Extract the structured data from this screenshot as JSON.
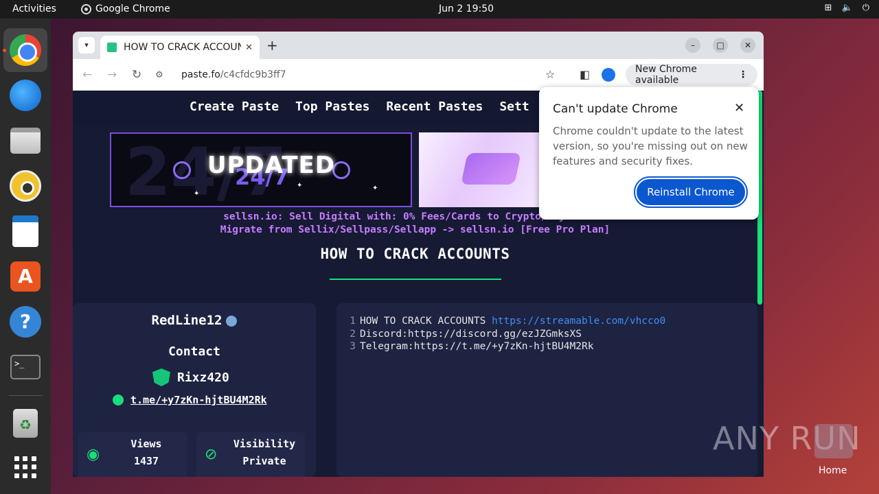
{
  "topbar": {
    "activities": "Activities",
    "app_name": "Google Chrome",
    "clock": "Jun 2  19:50"
  },
  "dock": {
    "items": [
      "chrome-icon",
      "thunderbird-icon",
      "files-icon",
      "rhythmbox-icon",
      "writer-icon",
      "app-center-icon",
      "help-icon",
      "terminal-icon",
      "trash-icon",
      "show-apps-icon"
    ]
  },
  "browser": {
    "tab_title": "HOW TO CRACK ACCOUNTS",
    "url_host": "paste.fo",
    "url_path": "/c4cfdc9b3ff7",
    "update_pill": "New Chrome available"
  },
  "site": {
    "nav": [
      "Create Paste",
      "Top Pastes",
      "Recent Pastes",
      "Sett"
    ],
    "banner1_text": "UPDATED",
    "banner1_sub": "24/7",
    "promo_line1": "sellsn.io: Sell Digital with: 0% Fees/Cards to Crypto/PayPal F2F",
    "promo_line2": "Migrate from Sellix/Sellpass/Sellapp -> sellsn.io [Free Pro Plan]",
    "paste_title": "HOW TO CRACK ACCOUNTS"
  },
  "user": {
    "name": "RedLine12",
    "contact_label": "Contact",
    "handle": "Rixz420",
    "telegram_link": "t.me/+y7zKn-hjtBU4M2Rk",
    "views_label": "Views",
    "views_value": "1437",
    "visibility_label": "Visibility",
    "visibility_value": "Private"
  },
  "code": {
    "lines": [
      {
        "n": "1",
        "text": "HOW TO CRACK ACCOUNTS ",
        "url": "https://streamable.com/vhcco0"
      },
      {
        "n": "2",
        "text": "Discord:https://discord.gg/ezJZGmksXS",
        "url": ""
      },
      {
        "n": "3",
        "text": "Telegram:https://t.me/+y7zKn-hjtBU4M2Rk",
        "url": ""
      }
    ]
  },
  "popup": {
    "title": "Can't update Chrome",
    "body": "Chrome couldn't update to the latest version, so you're missing out on new features and security fixes.",
    "button": "Reinstall Chrome"
  },
  "desktop": {
    "watermark": "ANY RUN",
    "home_label": "Home"
  },
  "colors": {
    "accent_green": "#16e07a",
    "promo_purple": "#c77dff",
    "link_blue": "#3e8ef7",
    "chrome_blue": "#0b57d0"
  }
}
